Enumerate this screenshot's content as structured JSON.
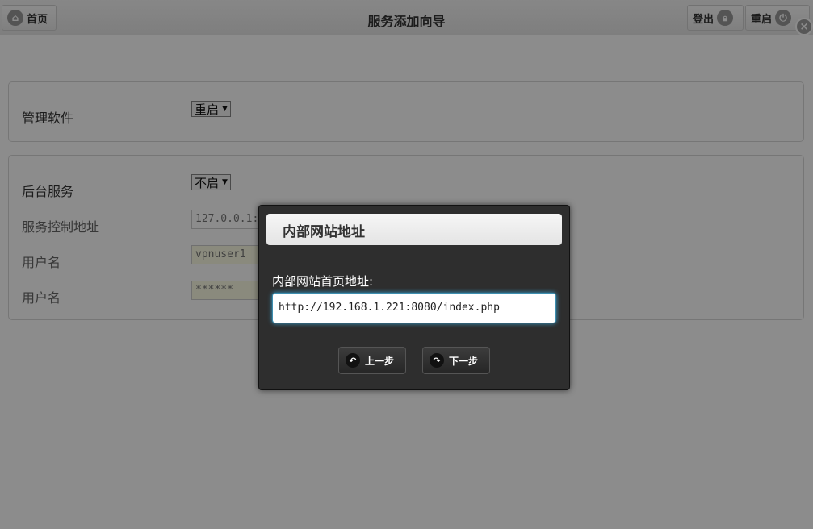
{
  "header": {
    "home_label": "首页",
    "title": "服务添加向导",
    "logout_label": "登出",
    "reboot_label": "重启"
  },
  "panel1": {
    "label": "管理软件",
    "select_value": "重启"
  },
  "panel2": {
    "label": "后台服务",
    "select_value": "不启",
    "rows": [
      {
        "label": "服务控制地址",
        "value": "127.0.0.1:"
      },
      {
        "label": "用户名",
        "value": "vpnuser1"
      },
      {
        "label": "用户名",
        "value": "******"
      }
    ]
  },
  "dialog": {
    "title": "内部网站地址",
    "field_label": "内部网站首页地址:",
    "field_value": "http://192.168.1.221:8080/index.php",
    "prev_label": "上一步",
    "next_label": "下一步"
  }
}
